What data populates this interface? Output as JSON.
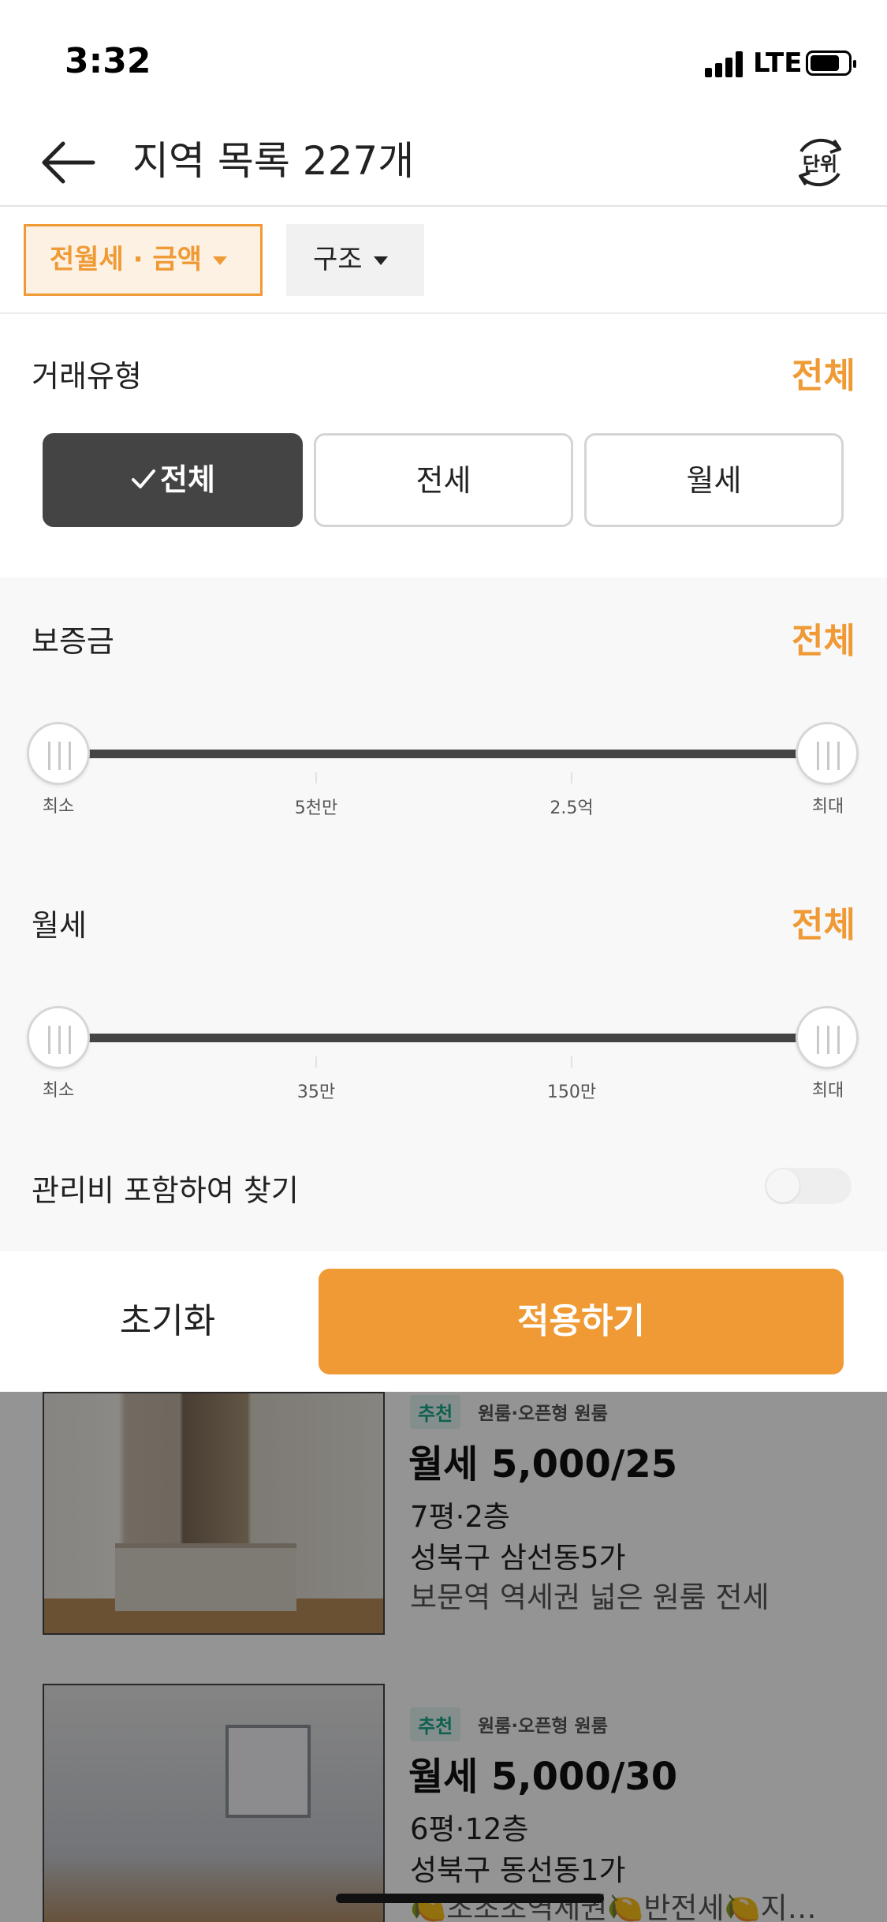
{
  "status_bar": {
    "time": "3:32",
    "network": "LTE"
  },
  "nav": {
    "title": "지역 목록 227개",
    "unit_label": "단위"
  },
  "filters": {
    "price_chip": "전월세 · 금액",
    "structure_chip": "구조"
  },
  "trade_type": {
    "label": "거래유형",
    "value": "전체",
    "options": [
      "전체",
      "전세",
      "월세"
    ],
    "selected": "전체"
  },
  "deposit": {
    "label": "보증금",
    "value": "전체",
    "ticks": [
      "최소",
      "5천만",
      "2.5억",
      "최대"
    ]
  },
  "monthly_rent": {
    "label": "월세",
    "value": "전체",
    "ticks": [
      "최소",
      "35만",
      "150만",
      "최대"
    ]
  },
  "maintenance_fee": {
    "label": "관리비 포함하여 찾기",
    "enabled": false
  },
  "actions": {
    "reset": "초기화",
    "apply": "적용하기"
  },
  "listings": [
    {
      "badge": "추천",
      "type": "원룸·오픈형 원룸",
      "price": "월세 5,000/25",
      "size_floor": "7평·2층",
      "address": "성북구 삼선동5가",
      "description": "보문역 역세권 넓은 원룸 전세"
    },
    {
      "badge": "추천",
      "type": "원룸·오픈형 원룸",
      "price": "월세 5,000/30",
      "size_floor": "6평·12층",
      "address": "성북구 동선동1가",
      "description": "🍋초초초역세권🍋반전세🍋지…"
    }
  ],
  "colors": {
    "accent": "#ef9a35",
    "dark": "#444444",
    "badge_green": "#1aa58c"
  }
}
